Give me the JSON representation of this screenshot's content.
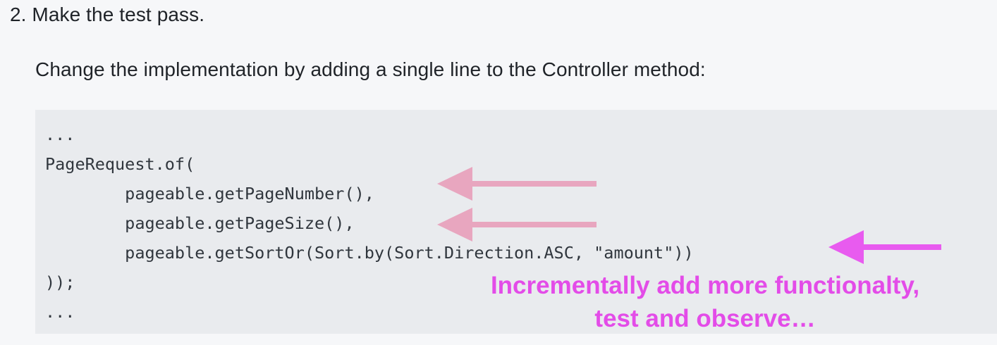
{
  "step": {
    "heading": "2. Make the test pass."
  },
  "intro": {
    "text": "Change the implementation by adding a single line to the Controller method:"
  },
  "code": {
    "lines": [
      "...",
      "PageRequest.of(",
      "        pageable.getPageNumber(),",
      "        pageable.getPageSize(),",
      "        pageable.getSortOr(Sort.by(Sort.Direction.ASC, \"amount\"))",
      "));",
      "..."
    ]
  },
  "annotation": {
    "line1": "Incrementally add more functionalty,",
    "line2": "test and observe…",
    "arrow_color_light": "#e8a6bf",
    "arrow_color_strong": "#e85bef",
    "text_color": "#e34ce8"
  }
}
